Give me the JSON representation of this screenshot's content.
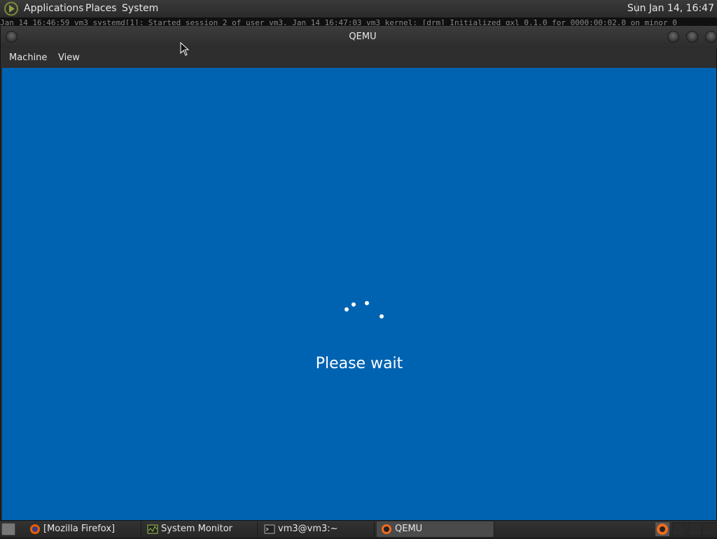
{
  "top_panel": {
    "menus": [
      "Applications",
      "Places",
      "System"
    ],
    "clock": "Sun Jan 14, 16:47"
  },
  "background_terminal_text": "Jan 14 16:46:59 vm3 systemd[1]: Started session 2 of user vm3. Jan 14 16:47:03 vm3 kernel: [drm] Initialized qxl 0.1.0 for 0000:00:02.0 on minor 0",
  "window": {
    "title": "QEMU",
    "menus": [
      "Machine",
      "View"
    ]
  },
  "guest": {
    "status_text": "Please wait",
    "background_color": "#0063b1"
  },
  "taskbar": {
    "tasks": [
      {
        "label": "[Mozilla Firefox]",
        "icon": "firefox-icon"
      },
      {
        "label": "System Monitor",
        "icon": "system-monitor-icon"
      },
      {
        "label": "vm3@vm3:~",
        "icon": "terminal-icon"
      },
      {
        "label": "QEMU",
        "icon": "qemu-icon",
        "active": true
      }
    ]
  },
  "colors": {
    "panel": "#2e2e2e",
    "guest_blue": "#0063b1",
    "text": "#e6e6e6"
  }
}
